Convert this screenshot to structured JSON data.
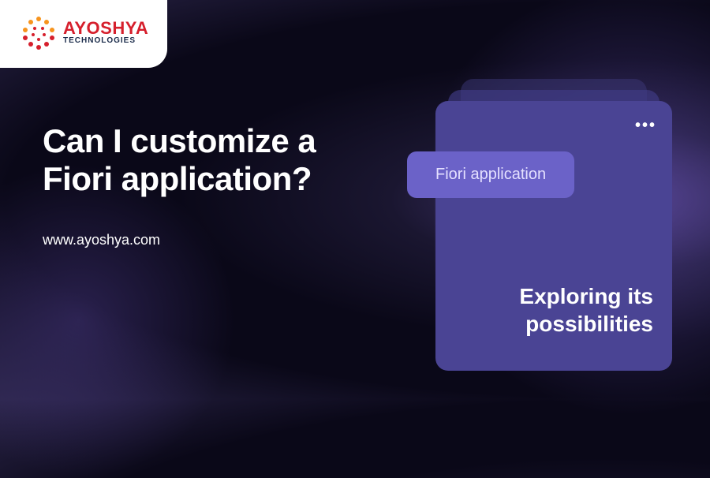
{
  "logo": {
    "brand": "AYOSHYA",
    "sub": "TECHNOLOGIES"
  },
  "headline": "Can I customize a Fiori application?",
  "url": "www.ayoshya.com",
  "card": {
    "pill_label": "Fiori application",
    "body_line1": "Exploring its",
    "body_line2": "possibilities",
    "more_icon": "•••"
  }
}
